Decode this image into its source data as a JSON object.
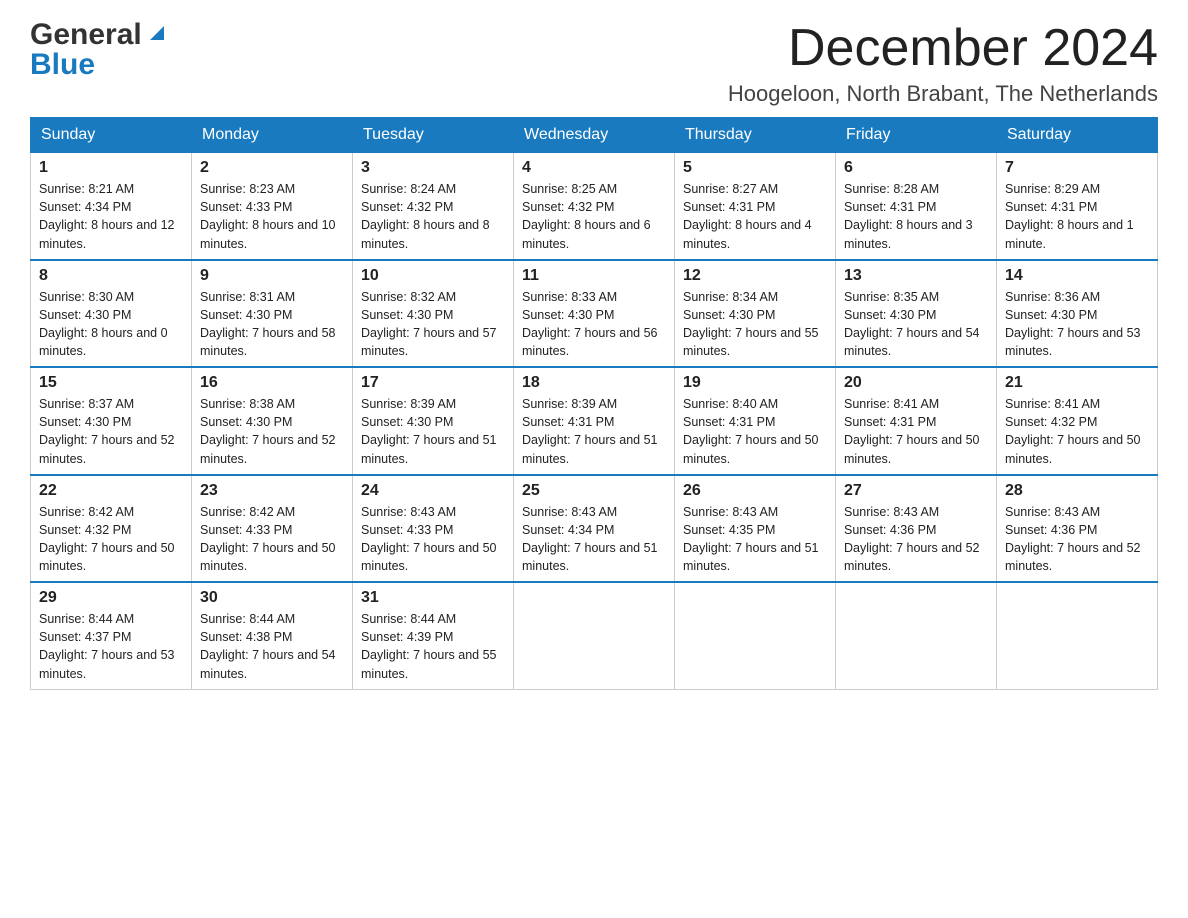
{
  "header": {
    "logo_general": "General",
    "logo_blue": "Blue",
    "month_title": "December 2024",
    "location": "Hoogeloon, North Brabant, The Netherlands"
  },
  "days_of_week": [
    "Sunday",
    "Monday",
    "Tuesday",
    "Wednesday",
    "Thursday",
    "Friday",
    "Saturday"
  ],
  "weeks": [
    [
      {
        "day": "1",
        "sunrise": "8:21 AM",
        "sunset": "4:34 PM",
        "daylight": "8 hours and 12 minutes."
      },
      {
        "day": "2",
        "sunrise": "8:23 AM",
        "sunset": "4:33 PM",
        "daylight": "8 hours and 10 minutes."
      },
      {
        "day": "3",
        "sunrise": "8:24 AM",
        "sunset": "4:32 PM",
        "daylight": "8 hours and 8 minutes."
      },
      {
        "day": "4",
        "sunrise": "8:25 AM",
        "sunset": "4:32 PM",
        "daylight": "8 hours and 6 minutes."
      },
      {
        "day": "5",
        "sunrise": "8:27 AM",
        "sunset": "4:31 PM",
        "daylight": "8 hours and 4 minutes."
      },
      {
        "day": "6",
        "sunrise": "8:28 AM",
        "sunset": "4:31 PM",
        "daylight": "8 hours and 3 minutes."
      },
      {
        "day": "7",
        "sunrise": "8:29 AM",
        "sunset": "4:31 PM",
        "daylight": "8 hours and 1 minute."
      }
    ],
    [
      {
        "day": "8",
        "sunrise": "8:30 AM",
        "sunset": "4:30 PM",
        "daylight": "8 hours and 0 minutes."
      },
      {
        "day": "9",
        "sunrise": "8:31 AM",
        "sunset": "4:30 PM",
        "daylight": "7 hours and 58 minutes."
      },
      {
        "day": "10",
        "sunrise": "8:32 AM",
        "sunset": "4:30 PM",
        "daylight": "7 hours and 57 minutes."
      },
      {
        "day": "11",
        "sunrise": "8:33 AM",
        "sunset": "4:30 PM",
        "daylight": "7 hours and 56 minutes."
      },
      {
        "day": "12",
        "sunrise": "8:34 AM",
        "sunset": "4:30 PM",
        "daylight": "7 hours and 55 minutes."
      },
      {
        "day": "13",
        "sunrise": "8:35 AM",
        "sunset": "4:30 PM",
        "daylight": "7 hours and 54 minutes."
      },
      {
        "day": "14",
        "sunrise": "8:36 AM",
        "sunset": "4:30 PM",
        "daylight": "7 hours and 53 minutes."
      }
    ],
    [
      {
        "day": "15",
        "sunrise": "8:37 AM",
        "sunset": "4:30 PM",
        "daylight": "7 hours and 52 minutes."
      },
      {
        "day": "16",
        "sunrise": "8:38 AM",
        "sunset": "4:30 PM",
        "daylight": "7 hours and 52 minutes."
      },
      {
        "day": "17",
        "sunrise": "8:39 AM",
        "sunset": "4:30 PM",
        "daylight": "7 hours and 51 minutes."
      },
      {
        "day": "18",
        "sunrise": "8:39 AM",
        "sunset": "4:31 PM",
        "daylight": "7 hours and 51 minutes."
      },
      {
        "day": "19",
        "sunrise": "8:40 AM",
        "sunset": "4:31 PM",
        "daylight": "7 hours and 50 minutes."
      },
      {
        "day": "20",
        "sunrise": "8:41 AM",
        "sunset": "4:31 PM",
        "daylight": "7 hours and 50 minutes."
      },
      {
        "day": "21",
        "sunrise": "8:41 AM",
        "sunset": "4:32 PM",
        "daylight": "7 hours and 50 minutes."
      }
    ],
    [
      {
        "day": "22",
        "sunrise": "8:42 AM",
        "sunset": "4:32 PM",
        "daylight": "7 hours and 50 minutes."
      },
      {
        "day": "23",
        "sunrise": "8:42 AM",
        "sunset": "4:33 PM",
        "daylight": "7 hours and 50 minutes."
      },
      {
        "day": "24",
        "sunrise": "8:43 AM",
        "sunset": "4:33 PM",
        "daylight": "7 hours and 50 minutes."
      },
      {
        "day": "25",
        "sunrise": "8:43 AM",
        "sunset": "4:34 PM",
        "daylight": "7 hours and 51 minutes."
      },
      {
        "day": "26",
        "sunrise": "8:43 AM",
        "sunset": "4:35 PM",
        "daylight": "7 hours and 51 minutes."
      },
      {
        "day": "27",
        "sunrise": "8:43 AM",
        "sunset": "4:36 PM",
        "daylight": "7 hours and 52 minutes."
      },
      {
        "day": "28",
        "sunrise": "8:43 AM",
        "sunset": "4:36 PM",
        "daylight": "7 hours and 52 minutes."
      }
    ],
    [
      {
        "day": "29",
        "sunrise": "8:44 AM",
        "sunset": "4:37 PM",
        "daylight": "7 hours and 53 minutes."
      },
      {
        "day": "30",
        "sunrise": "8:44 AM",
        "sunset": "4:38 PM",
        "daylight": "7 hours and 54 minutes."
      },
      {
        "day": "31",
        "sunrise": "8:44 AM",
        "sunset": "4:39 PM",
        "daylight": "7 hours and 55 minutes."
      },
      null,
      null,
      null,
      null
    ]
  ],
  "labels": {
    "sunrise": "Sunrise:",
    "sunset": "Sunset:",
    "daylight": "Daylight:"
  }
}
